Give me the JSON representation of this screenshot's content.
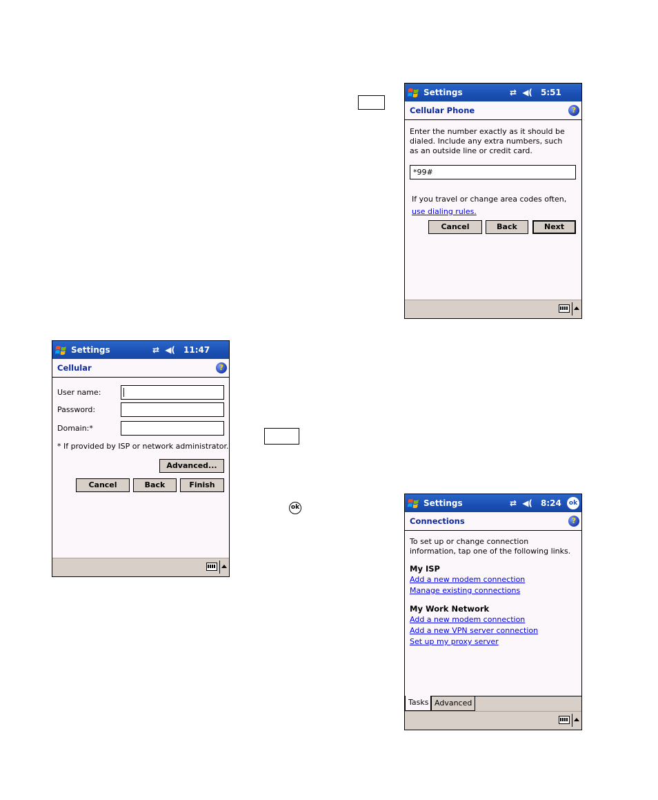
{
  "ok_glyph": "ok",
  "screen_cellular_phone": {
    "title": "Settings",
    "time": "5:51",
    "subtitle": "Cellular Phone",
    "instructions": "Enter the number exactly as it should be dialed.  Include any extra numbers, such as an outside line or credit card.",
    "number_value": "*99#",
    "travel_text": "If you travel or change area codes often,",
    "dialing_rules_link": "use dialing rules.",
    "buttons": {
      "cancel": "Cancel",
      "back": "Back",
      "next": "Next"
    }
  },
  "screen_cellular": {
    "title": "Settings",
    "time": "11:47",
    "subtitle": "Cellular",
    "labels": {
      "user_name": "User name:",
      "password": "Password:",
      "domain": "Domain:*"
    },
    "note": "* If provided by ISP or network administrator.",
    "buttons": {
      "advanced": "Advanced...",
      "cancel": "Cancel",
      "back": "Back",
      "finish": "Finish"
    }
  },
  "screen_connections": {
    "title": "Settings",
    "time": "8:24",
    "ok": "ok",
    "subtitle": "Connections",
    "intro": "To set up or change connection information, tap one of the following links.",
    "my_isp": {
      "heading": "My ISP",
      "links": [
        "Add a new modem connection",
        "Manage existing connections"
      ]
    },
    "my_work": {
      "heading": "My Work Network",
      "links": [
        "Add a new modem connection",
        "Add a new VPN server connection",
        "Set up my proxy server"
      ]
    },
    "tabs": [
      "Tasks",
      "Advanced"
    ]
  },
  "icons": {
    "start": "windows-flag-icon",
    "connectivity": "connectivity-icon",
    "speaker": "speaker-icon",
    "help": "help-icon",
    "keyboard": "keyboard-icon",
    "sip_arrow": "arrow-up-icon"
  }
}
